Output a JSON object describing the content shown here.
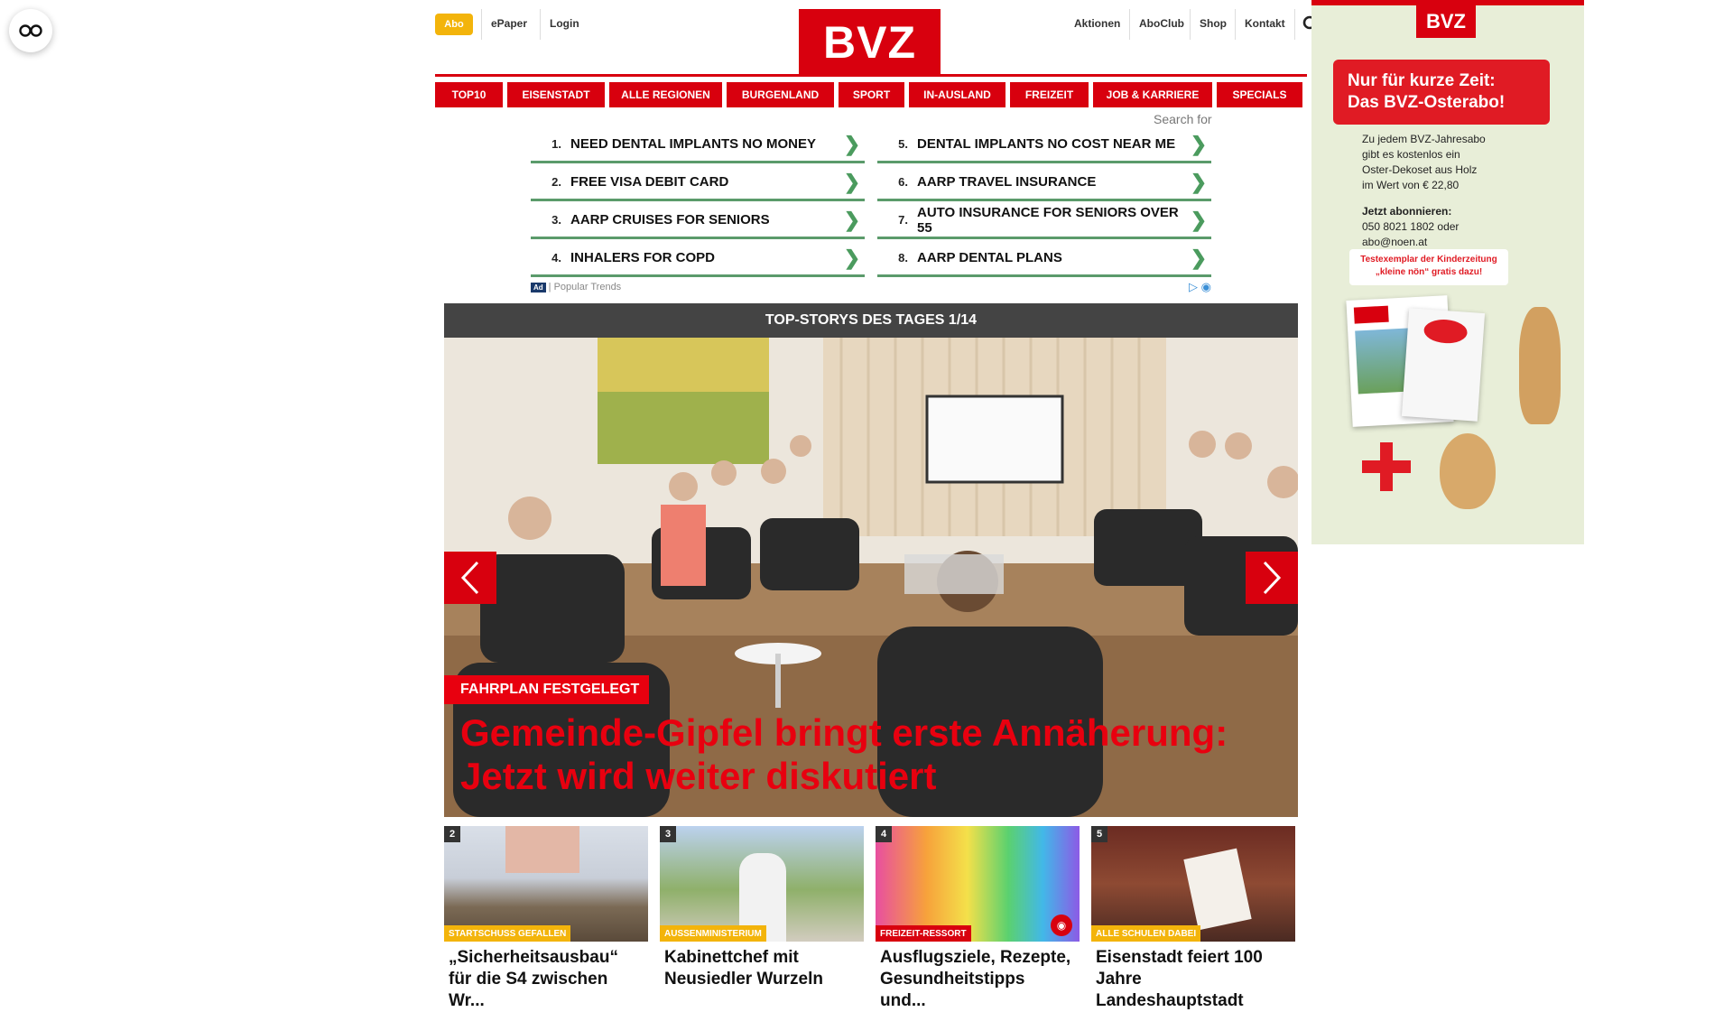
{
  "header": {
    "abo": "Abo",
    "epaper": "ePaper",
    "login": "Login",
    "logo": "BVZ",
    "right_links": [
      "Aktionen",
      "AboClub",
      "Shop",
      "Kontakt"
    ]
  },
  "nav": [
    "TOP10",
    "EISENSTADT",
    "ALLE REGIONEN",
    "BURGENLAND",
    "SPORT",
    "IN-AUSLAND",
    "FREIZEIT",
    "JOB & KARRIERE",
    "SPECIALS"
  ],
  "ad_links": {
    "search_for": "Search for",
    "left": [
      {
        "num": "1.",
        "text": "NEED DENTAL IMPLANTS NO MONEY"
      },
      {
        "num": "2.",
        "text": "FREE VISA DEBIT CARD"
      },
      {
        "num": "3.",
        "text": "AARP CRUISES FOR SENIORS"
      },
      {
        "num": "4.",
        "text": "INHALERS FOR COPD"
      }
    ],
    "right": [
      {
        "num": "5.",
        "text": "DENTAL IMPLANTS NO COST NEAR ME"
      },
      {
        "num": "6.",
        "text": "AARP TRAVEL INSURANCE"
      },
      {
        "num": "7.",
        "text": "AUTO INSURANCE FOR SENIORS OVER 55"
      },
      {
        "num": "8.",
        "text": "AARP DENTAL PLANS"
      }
    ],
    "badge": "Ad",
    "footer": "| Popular Trends"
  },
  "top_stories": {
    "bar_title": "TOP-STORYS DES TAGES 1/14",
    "kicker": "FAHRPLAN FESTGELEGT",
    "headline": "Gemeinde-Gipfel bringt erste Annäherung: Jetzt wird weiter diskutiert"
  },
  "cards": [
    {
      "nr": "2",
      "tag": "STARTSCHUSS GEFALLEN",
      "tag_color": "#f3b40b",
      "title": "„Sicherheitsausbau“ für die S4 zwischen Wr..."
    },
    {
      "nr": "3",
      "tag": "AUSSENMINISTERIUM",
      "tag_color": "#f3b40b",
      "title": "Kabinettchef mit Neusiedler Wurzeln"
    },
    {
      "nr": "4",
      "tag": "FREIZEIT-RESSORT",
      "tag_color": "#d8000e",
      "title": "Ausflugsziele, Rezepte, Gesundheitstipps und..."
    },
    {
      "nr": "5",
      "tag": "ALLE SCHULEN DABEI",
      "tag_color": "#f3b40b",
      "title": "Eisenstadt feiert 100 Jahre Landeshauptstadt"
    }
  ],
  "side_ad": {
    "logo": "BVZ",
    "headline_line1": "Nur für kurze Zeit:",
    "headline_line2": "Das BVZ-Osterabo!",
    "body_line1": "Zu jedem BVZ-Jahresabo",
    "body_line2": "gibt es kostenlos ein",
    "body_line3": "Oster-Dekoset aus Holz",
    "body_line4": "im Wert von € 22,80",
    "cta_title": "Jetzt abonnieren:",
    "cta_phone": "050 8021 1802 oder",
    "cta_mail": "abo@noen.at",
    "extra_line1": "Testexemplar der Kinderzeitung",
    "extra_line2": "„kleine nön“ gratis dazu!"
  },
  "colors": {
    "brand_red": "#d8000e",
    "abo_yellow": "#f3b40b",
    "ad_green": "#5b9b6b"
  }
}
